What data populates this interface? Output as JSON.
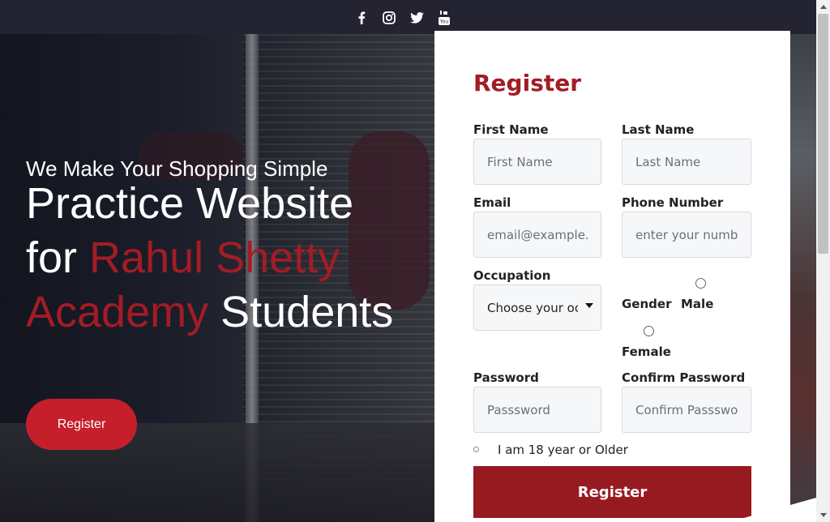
{
  "social": {
    "icons": [
      "facebook-icon",
      "instagram-icon",
      "twitter-icon",
      "youtube-icon"
    ]
  },
  "hero": {
    "tagline": "We Make Your Shopping Simple",
    "headline_part1": "Practice Website for ",
    "headline_accent": "Rahul Shetty Academy",
    "headline_part2": " Students",
    "button_label": "Register",
    "accent_color": "#a31c25"
  },
  "form": {
    "title": "Register",
    "first_name": {
      "label": "First Name",
      "placeholder": "First Name",
      "value": ""
    },
    "last_name": {
      "label": "Last Name",
      "placeholder": "Last Name",
      "value": ""
    },
    "email": {
      "label": "Email",
      "placeholder": "email@example.com",
      "value": ""
    },
    "phone": {
      "label": "Phone Number",
      "placeholder": "enter your number",
      "value": ""
    },
    "occupation": {
      "label": "Occupation",
      "selected": "Choose your occupation"
    },
    "gender": {
      "label": "Gender",
      "options": [
        "Male",
        "Female"
      ]
    },
    "password": {
      "label": "Password",
      "placeholder": "Passsword",
      "value": ""
    },
    "confirm_password": {
      "label": "Confirm Password",
      "placeholder": "Confirm Passsword",
      "value": ""
    },
    "age_check_label": "I am 18 year or Older",
    "submit_label": "Register",
    "submit_color": "#981a21"
  }
}
